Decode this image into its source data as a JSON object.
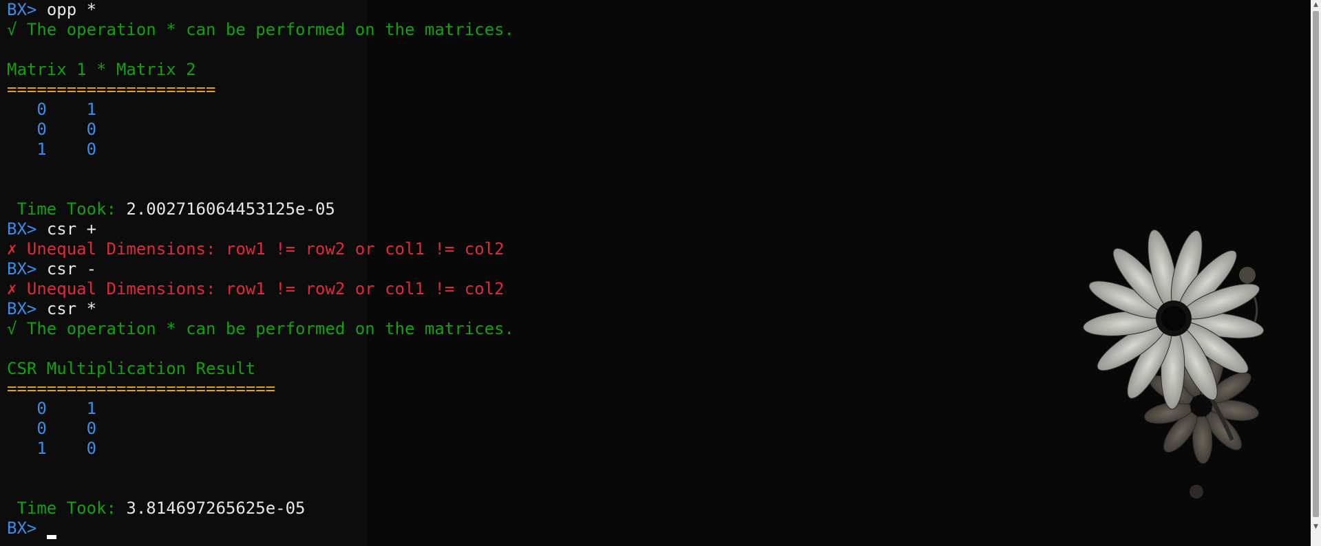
{
  "terminal": {
    "prompt": "BX>",
    "lines": [
      {
        "kind": "cmd",
        "text": "opp *"
      },
      {
        "kind": "ok",
        "text": "√ The operation * can be performed on the matrices."
      },
      {
        "kind": "blank",
        "text": ""
      },
      {
        "kind": "ok",
        "text": "Matrix 1 * Matrix 2"
      },
      {
        "kind": "rule",
        "text": "====================="
      },
      {
        "kind": "num",
        "text": "   0    1"
      },
      {
        "kind": "num",
        "text": "   0    0"
      },
      {
        "kind": "num",
        "text": "   1    0"
      },
      {
        "kind": "blank",
        "text": ""
      },
      {
        "kind": "blank",
        "text": ""
      },
      {
        "kind": "time",
        "label": " Time Took:",
        "value": " 2.002716064453125e-05"
      },
      {
        "kind": "cmd",
        "text": "csr +"
      },
      {
        "kind": "err",
        "text": "✗ Unequal Dimensions: row1 != row2 or col1 != col2"
      },
      {
        "kind": "cmd",
        "text": "csr -"
      },
      {
        "kind": "err",
        "text": "✗ Unequal Dimensions: row1 != row2 or col1 != col2"
      },
      {
        "kind": "cmd",
        "text": "csr *"
      },
      {
        "kind": "ok",
        "text": "√ The operation * can be performed on the matrices."
      },
      {
        "kind": "blank",
        "text": ""
      },
      {
        "kind": "ok",
        "text": "CSR Multiplication Result"
      },
      {
        "kind": "rule",
        "text": "==========================="
      },
      {
        "kind": "num",
        "text": "   0    1"
      },
      {
        "kind": "num",
        "text": "   0    0"
      },
      {
        "kind": "num",
        "text": "   1    0"
      },
      {
        "kind": "blank",
        "text": ""
      },
      {
        "kind": "blank",
        "text": ""
      },
      {
        "kind": "time",
        "label": " Time Took:",
        "value": " 3.814697265625e-05"
      },
      {
        "kind": "input",
        "text": ""
      }
    ]
  },
  "scrollbar": {
    "up_icon": "triangle-up-icon",
    "down_icon": "triangle-down-icon",
    "up_glyph": "▲",
    "down_glyph": "▼"
  },
  "colors": {
    "background": "#0c0c0c",
    "prompt": "#3b8eea",
    "success": "#13a10e",
    "error": "#e0293a",
    "rule": "#e5a50a"
  },
  "background_image": "daisy-flower"
}
